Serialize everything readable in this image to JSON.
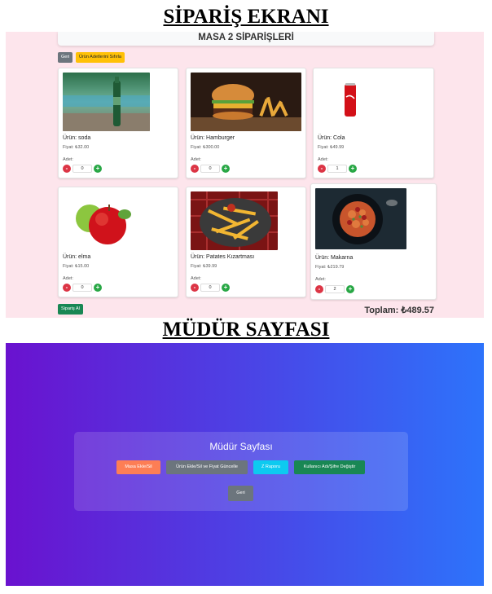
{
  "headings": {
    "order_screen": "SİPARİŞ EKRANI",
    "manager_screen": "MÜDÜR SAYFASI"
  },
  "order": {
    "masa_title": "MASA 2 SİPARİŞLERİ",
    "back_label": "Geri",
    "reset_label": "Ürün Adetlerini Sıfırla",
    "qty_label": "Adet:",
    "products": [
      {
        "name": "Ürün: soda",
        "price": "Fiyat: ₺32.00",
        "qty": "0",
        "image": "soda-bottle-image"
      },
      {
        "name": "Ürün: Hamburger",
        "price": "Fiyat: ₺300.00",
        "qty": "0",
        "image": "hamburger-image"
      },
      {
        "name": "Ürün: Cola",
        "price": "Fiyat: ₺49.99",
        "qty": "1",
        "image": "cola-can-image"
      },
      {
        "name": "Ürün: elma",
        "price": "Fiyat: ₺15.00",
        "qty": "0",
        "image": "apple-image"
      },
      {
        "name": "Ürün: Patates Kızartması",
        "price": "Fiyat: ₺39.99",
        "qty": "0",
        "image": "fries-image"
      },
      {
        "name": "Ürün: Makarna",
        "price": "Fiyat: ₺219.79",
        "qty": "2",
        "image": "pasta-image"
      }
    ],
    "minus_symbol": "-",
    "plus_symbol": "+",
    "submit_label": "Sipariş Al",
    "total": "Toplam: ₺489.57"
  },
  "manager": {
    "title": "Müdür Sayfası",
    "buttons": [
      {
        "label": "Masa Ekle/Sil",
        "color": "#fd7e55"
      },
      {
        "label": "Ürün Ekle/Sil ve Fiyat Güncelle",
        "color": "#6c757d"
      },
      {
        "label": "Z Raporu",
        "color": "#0dcaf0"
      },
      {
        "label": "Kullanıcı Adı/Şifre Değiştir",
        "color": "#198754"
      }
    ],
    "back_label": "Geri"
  }
}
